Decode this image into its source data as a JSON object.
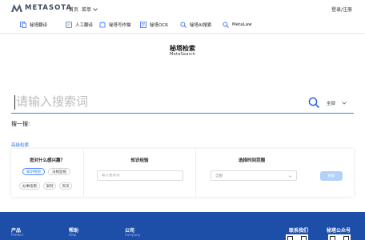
{
  "header": {
    "logo_text": "METASOTA",
    "nav_home": "首页",
    "nav_menu": "菜单",
    "login": "登录/注册"
  },
  "toolbar": {
    "items": [
      {
        "label": "秘塔翻译",
        "icon": "translate-doc-icon"
      },
      {
        "label": "人工翻译",
        "icon": "human-translate-icon"
      },
      {
        "label": "秘塔写作猫",
        "icon": "writing-cat-icon"
      },
      {
        "label": "秘塔OCR",
        "icon": "ocr-icon"
      },
      {
        "label": "秘塔AI搜索",
        "icon": "search-icon"
      },
      {
        "label": "MetaLaw",
        "icon": "search-icon"
      }
    ]
  },
  "hero": {
    "title": "秘塔检索",
    "subtitle": "MetaSearch"
  },
  "search": {
    "placeholder": "请输入搜索词",
    "scope": "全部"
  },
  "labels": {
    "sou_yi_sou": "搜一搜:",
    "advanced": "高级检索"
  },
  "panel": {
    "interest_title": "您对什么感兴趣？",
    "chips": [
      "知识经验",
      "法规监规",
      "办事指南",
      "案例",
      "资讯"
    ],
    "active_chip": 0,
    "knowledge_title": "知识经验",
    "knowledge_placeholder": "输入搜索词",
    "time_title": "选择时间范围",
    "time_value": "全部",
    "go_label": "搜索"
  },
  "footer": {
    "col1_title": "产品",
    "col1_sub": "Product",
    "col2_title": "帮助",
    "col2_sub": "Help",
    "col3_title": "公司",
    "col3_sub": "Company",
    "contact": "联系我们",
    "wechat": "秘塔公众号"
  },
  "colors": {
    "accent": "#2f6fed",
    "footer": "#1e4fa8",
    "button_disabled": "#b3d2fb"
  }
}
